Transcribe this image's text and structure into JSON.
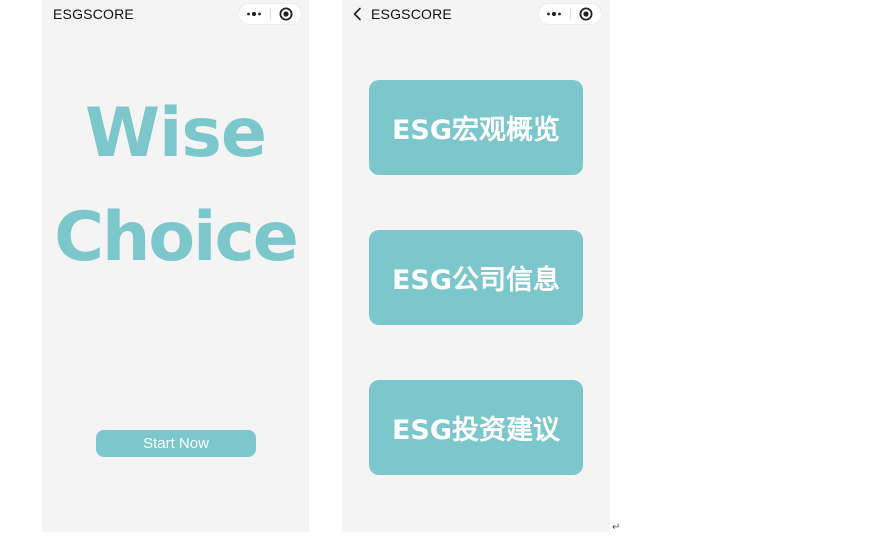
{
  "left_screen": {
    "nav_title": "ESGSCORE",
    "hero_line_1": "Wise",
    "hero_line_2": "Choice",
    "start_button_label": "Start Now"
  },
  "right_screen": {
    "nav_title": "ESGSCORE",
    "menu_items": [
      {
        "label": "ESG宏观概览"
      },
      {
        "label": "ESG公司信息"
      },
      {
        "label": "ESG投资建议"
      }
    ]
  },
  "icons": {
    "more": "more-dots-icon",
    "close": "target-circle-icon",
    "back": "chevron-left-icon"
  },
  "colors": {
    "accent": "#7cc7cb",
    "screen_background": "#f4f4f5",
    "page_background": "#ffffff"
  },
  "document_mark": "↵"
}
